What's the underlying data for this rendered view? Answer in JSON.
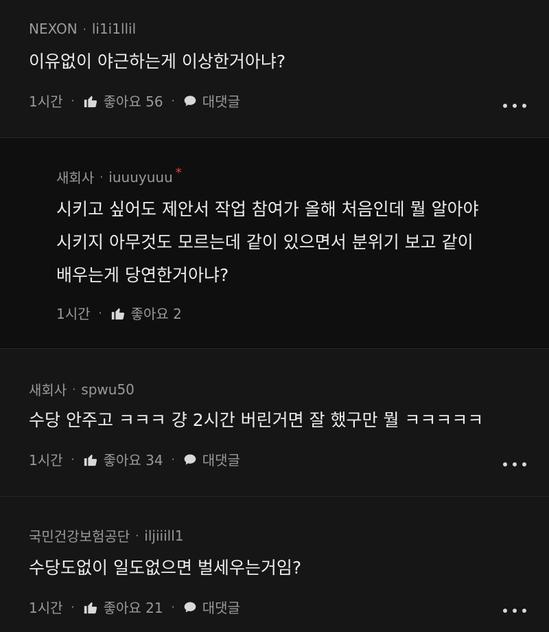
{
  "comments": [
    {
      "author": "NEXON",
      "username": "li1i1llil",
      "text_lines": [
        "이유없이 야근하는게 이상한거아냐?"
      ],
      "time": "1시간",
      "like_label": "좋아요 56",
      "reply_label": "대댓글"
    },
    {
      "author": "새회사",
      "username": "iuuuyuuu",
      "badge": "*",
      "text_lines": [
        "시키고 싶어도 제안서 작업 참여가 올해 처음인데 뭘 알아야",
        "시키지 아무것도 모르는데 같이 있으면서 분위기 보고 같이",
        "배우는게 당연한거아냐?"
      ],
      "time": "1시간",
      "like_label": "좋아요 2"
    },
    {
      "author": "새회사",
      "username": "spwu50",
      "text_lines": [
        "수당 안주고 ㅋㅋㅋ 걍 2시간 버린거면 잘 했구만 뭘 ㅋㅋㅋㅋㅋ"
      ],
      "time": "1시간",
      "like_label": "좋아요 34",
      "reply_label": "대댓글"
    },
    {
      "author": "국민건강보험공단",
      "username": "iljiiill1",
      "text_lines": [
        "수당도없이 일도없으면 벌세우는거임?"
      ],
      "time": "1시간",
      "like_label": "좋아요 21",
      "reply_label": "대댓글"
    }
  ],
  "separator": "·",
  "icons": {
    "like": "thumbs-up-icon",
    "reply": "chat-bubble-icon",
    "more": "more-dots-icon"
  },
  "colors": {
    "background": "#161617",
    "reply_background": "#0f0f10",
    "meta_text": "#9a9a9c",
    "body_text": "#ececec",
    "badge": "#e0453a"
  }
}
